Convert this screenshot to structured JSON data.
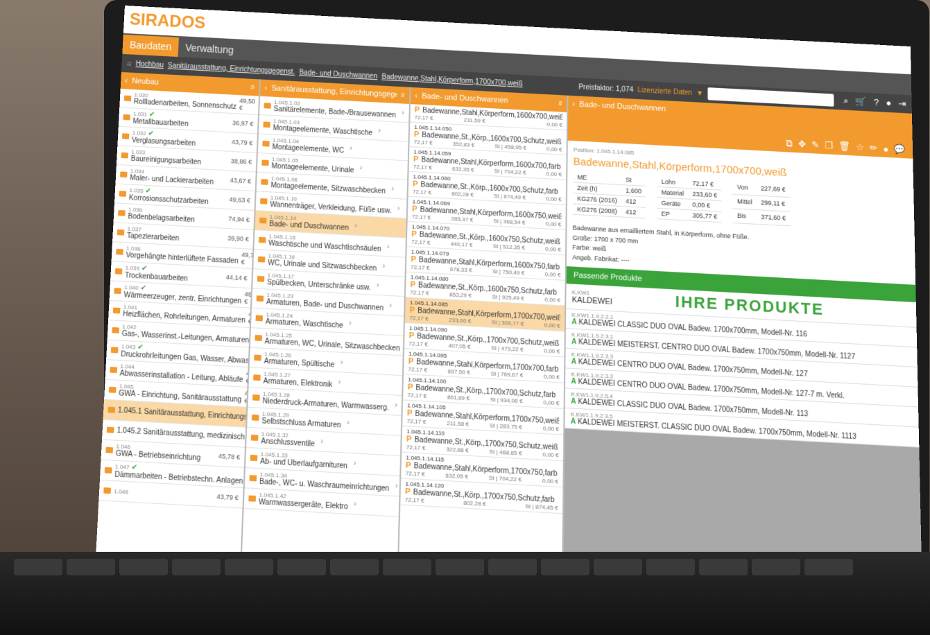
{
  "app": {
    "logo": "SIRADOS"
  },
  "nav": {
    "tabs": [
      "Baudaten",
      "Verwaltung"
    ]
  },
  "infobar": {
    "breadcrumbs": [
      "Hochbau",
      "Sanitärausstattung, Einrichtungsgegenst.",
      "Bade- und Duschwannen",
      "Badewanne,Stahl,Körperform,1700x700,weiß"
    ],
    "price_factor": "Preisfaktor: 1,074",
    "licensed": "Lizenzierte Daten"
  },
  "icons": [
    "home-icon",
    "search-icon",
    "cart-icon",
    "help-icon",
    "user-icon",
    "logout-icon",
    "filter-icon"
  ],
  "col1": {
    "title": "Neubau",
    "items": [
      {
        "code": "1.030",
        "label": "Rollladenarbeiten, Sonnenschutz",
        "price": "49,50 €"
      },
      {
        "code": "1.031",
        "label": "Metallbauarbeiten",
        "price": "36,97 €",
        "ok": true
      },
      {
        "code": "1.032",
        "label": "Verglasungsarbeiten",
        "price": "43,79 €",
        "ok": true
      },
      {
        "code": "1.033",
        "label": "Baureinigungsarbeiten",
        "price": "38,86 €"
      },
      {
        "code": "1.034",
        "label": "Maler- und Lackierarbeiten",
        "price": "43,67 €"
      },
      {
        "code": "1.035",
        "label": "Korrosionsschutzarbeiten",
        "price": "49,63 €",
        "ok": true
      },
      {
        "code": "1.036",
        "label": "Bodenbelagsarbeiten",
        "price": "74,94 €"
      },
      {
        "code": "1.037",
        "label": "Tapezierarbeiten",
        "price": "39,90 €"
      },
      {
        "code": "1.038",
        "label": "Vorgehängte hinterlüftete Fassaden",
        "price": "49,74 €"
      },
      {
        "code": "1.039",
        "label": "Trockenbauarbeiten",
        "price": "44,14 €",
        "ok": true
      },
      {
        "code": "1.040",
        "label": "Wärmeerzeuger, zentr. Einrichtungen",
        "price": "46,11 €",
        "ok": true
      },
      {
        "code": "1.041",
        "label": "Heizflächen, Rohrleitungen, Armaturen",
        "price": "49,11 €"
      },
      {
        "code": "1.042",
        "label": "Gas-, Wasserinst.-Leitungen, Armaturen",
        "price": "46,11 €"
      },
      {
        "code": "1.043",
        "label": "Druckrohrleitungen Gas, Wasser, Abwasser",
        "price": "48,11 €",
        "ok": true
      },
      {
        "code": "1.044",
        "label": "Abwasserinstallation - Leitung, Abläufe",
        "price": "42,44 €"
      },
      {
        "code": "1.045",
        "label": "GWA - Einrichtung, Sanitärausstattung",
        "price": "49,11 €"
      },
      {
        "code": "",
        "label": "1.045.1 Sanitärausstattung, Einrichtungsgegenst.",
        "price": "",
        "selected": true
      },
      {
        "code": "",
        "label": "1.045.2 Sanitärausstattung, medizinisch. Bereich",
        "price": ""
      },
      {
        "code": "1.046",
        "label": "GWA - Betriebseinrichtung",
        "price": "45,78 €"
      },
      {
        "code": "1.047",
        "label": "Dämmarbeiten - Betriebstechn. Anlagen",
        "price": "43,69 €",
        "ok": true
      },
      {
        "code": "1.048",
        "label": "",
        "price": "43,79 €"
      }
    ]
  },
  "col2": {
    "title": "Sanitärausstattung, Einrichtungsgegenst.",
    "items": [
      {
        "code": "1.045.1.02",
        "label": "Sanitärelemente, Bade-/Brausewannen"
      },
      {
        "code": "1.045.1.03",
        "label": "Montageelemente, Waschtische"
      },
      {
        "code": "1.045.1.04",
        "label": "Montageelemente, WC"
      },
      {
        "code": "1.045.1.05",
        "label": "Montageelemente, Urinale"
      },
      {
        "code": "1.045.1.06",
        "label": "Montageelemente, Sitzwaschbecken"
      },
      {
        "code": "1.045.1.10",
        "label": "Wannenträger, Verkleidung, Füße usw."
      },
      {
        "code": "1.045.1.14",
        "label": "Bade- und Duschwannen",
        "selected": true
      },
      {
        "code": "1.045.1.15",
        "label": "Waschtische und Waschtischsäulen"
      },
      {
        "code": "1.045.1.16",
        "label": "WC, Urinale und Sitzwaschbecken"
      },
      {
        "code": "1.045.1.17",
        "label": "Spülbecken, Unterschränke usw."
      },
      {
        "code": "1.045.1.23",
        "label": "Armaturen, Bade- und Duschwannen"
      },
      {
        "code": "1.045.1.24",
        "label": "Armaturen, Waschtische"
      },
      {
        "code": "1.045.1.25",
        "label": "Armaturen, WC, Urinale, Sitzwaschbecken"
      },
      {
        "code": "1.045.1.26",
        "label": "Armaturen, Spültische"
      },
      {
        "code": "1.045.1.27",
        "label": "Armaturen, Elektronik"
      },
      {
        "code": "1.045.1.28",
        "label": "Niederdruck-Armaturen, Warmwasserg."
      },
      {
        "code": "1.045.1.29",
        "label": "Selbstschluss Armaturen"
      },
      {
        "code": "1.045.1.32",
        "label": "Anschlussventile"
      },
      {
        "code": "1.045.1.33",
        "label": "Ab- und Überlaufgarnituren"
      },
      {
        "code": "1.045.1.34",
        "label": "Bade-, WC- u. Waschraumeinrichtungen"
      },
      {
        "code": "1.045.1.42",
        "label": "Warmwassergeräte, Elektro"
      }
    ]
  },
  "col3": {
    "title": "Bade- und Duschwannen",
    "items": [
      {
        "name": "Badewanne,Stahl,Körperform,1600x700,weiß",
        "code": "",
        "st": "",
        "ep": "72,17 €",
        "mat": "211,59 €",
        "extra": "0,00 €"
      },
      {
        "name": "Badewanne,St.,Körp.,1600x700,Schutz,weiß",
        "code": "1.045.1.14.050",
        "st": "St | 458,95 €",
        "ep": "72,17 €",
        "mat": "352,83 €",
        "extra": "0,00 €"
      },
      {
        "name": "Badewanne,Stahl,Körperform,1600x700,farb",
        "code": "1.045.1.14.059",
        "st": "St | 704,22 €",
        "ep": "72,17 €",
        "mat": "632,35 €",
        "extra": "0,00 €"
      },
      {
        "name": "Badewanne,St.,Körp.,1600x700,Schutz,farb",
        "code": "1.045.1.14.060",
        "st": "St | 874,49 €",
        "ep": "72,17 €",
        "mat": "802,28 €",
        "extra": "0,00 €"
      },
      {
        "name": "Badewanne,Stahl,Körperform,1600x750,weiß",
        "code": "1.045.1.14.069",
        "st": "St | 368,54 €",
        "ep": "72,17 €",
        "mat": "285,37 €",
        "extra": "0,00 €"
      },
      {
        "name": "Badewanne,St.,Körp.,1600x750,Schutz,weiß",
        "code": "1.045.1.14.070",
        "st": "St | 512,35 €",
        "ep": "72,17 €",
        "mat": "440,17 €",
        "extra": "0,00 €"
      },
      {
        "name": "Badewanne,Stahl,Körperform,1600x750,farb",
        "code": "1.045.1.14.079",
        "st": "St | 750,49 €",
        "ep": "72,17 €",
        "mat": "678,33 €",
        "extra": "0,00 €"
      },
      {
        "name": "Badewanne,St.,Körp.,1600x750,Schutz,farb",
        "code": "1.045.1.14.080",
        "st": "St | 925,49 €",
        "ep": "72,17 €",
        "mat": "853,29 €",
        "extra": "0,00 €"
      },
      {
        "name": "Badewanne,Stahl,Körperform,1700x700,weiß",
        "code": "1.045.1.14.085",
        "st": "St | 305,77 €",
        "ep": "72,17 €",
        "mat": "233,60 €",
        "extra": "0,00 €",
        "selected": true
      },
      {
        "name": "Badewanne,St.,Körp.,1700x700,Schutz,weiß",
        "code": "1.045.1.14.090",
        "st": "St | 479,22 €",
        "ep": "72,17 €",
        "mat": "407,05 €",
        "extra": "0,00 €"
      },
      {
        "name": "Badewanne,Stahl,Körperform,1700x700,farb",
        "code": "1.045.1.14.095",
        "st": "St | 769,67 €",
        "ep": "72,17 €",
        "mat": "697,50 €",
        "extra": "0,00 €"
      },
      {
        "name": "Badewanne,St.,Körp.,1700x700,Schutz,farb",
        "code": "1.045.1.14.100",
        "st": "St | 934,06 €",
        "ep": "72,17 €",
        "mat": "861,89 €",
        "extra": "0,00 €"
      },
      {
        "name": "Badewanne,Stahl,Körperform,1700x750,weiß",
        "code": "1.045.1.14.105",
        "st": "St | 283,75 €",
        "ep": "72,17 €",
        "mat": "211,58 €",
        "extra": "0,00 €"
      },
      {
        "name": "Badewanne,St.,Körp.,1700x750,Schutz,weiß",
        "code": "1.045.1.14.110",
        "st": "St | 468,85 €",
        "ep": "72,17 €",
        "mat": "322,88 €",
        "extra": "0,00 €"
      },
      {
        "name": "Badewanne,Stahl,Körperform,1700x750,farb",
        "code": "1.045.1.14.115",
        "st": "St | 704,22 €",
        "ep": "72,17 €",
        "mat": "632,05 €",
        "extra": "0,00 €"
      },
      {
        "name": "Badewanne,St.,Körp.,1700x750,Schutz,farb",
        "code": "1.045.1.14.120",
        "st": "St | 874,45 €",
        "ep": "72,17 €",
        "mat": "802,28 €",
        "extra": ""
      }
    ]
  },
  "detail": {
    "title": "Bade- und Duschwannen",
    "pos_code": "Position: 1.045.1.14.085",
    "name": "Badewanne,Stahl,Körperform,1700x700,weiß",
    "table1": [
      [
        "ME",
        "St"
      ],
      [
        "Zeit (h)",
        "1,600"
      ],
      [
        "KG276 (2016)",
        "412"
      ],
      [
        "KG276 (2008)",
        "412"
      ]
    ],
    "table2": [
      [
        "Lohn",
        "72,17 €"
      ],
      [
        "Material",
        "233,60 €"
      ],
      [
        "Geräte",
        "0,00 €"
      ],
      [
        "EP",
        "305,77 €"
      ]
    ],
    "table3": [
      [
        "Von",
        "227,69 €"
      ],
      [
        "Mittel",
        "299,11 €"
      ],
      [
        "Bis",
        "371,60 €"
      ]
    ],
    "desc": [
      "Badewanne aus emailliertem Stahl, in Körperform, ohne Füße.",
      "Größe: 1700 x 700 mm",
      "Farbe: weiß",
      "Angeb. Fabrikat: ----"
    ],
    "passende_head": "Passende Produkte",
    "brand": "KALDEWEI",
    "brand_code": "K.KW1",
    "banner": "IHRE PRODUKTE",
    "products": [
      {
        "code": "K.KW1.1.9.2.2.1",
        "name": "KALDEWEI CLASSIC DUO OVAL Badew. 1700x700mm, Modell-Nr. 116"
      },
      {
        "code": "K.KW1.1.9.2.3.1",
        "name": "KALDEWEI MEISTERST. CENTRO DUO OVAL Badew. 1700x750mm, Modell-Nr. 1127"
      },
      {
        "code": "K.KW1.1.9.2.3.3",
        "name": "KALDEWEI CENTRO DUO OVAL Badew. 1700x750mm, Modell-Nr. 127"
      },
      {
        "code": "K.KW1.1.9.2.3.3",
        "name": "KALDEWEI CENTRO DUO OVAL Badew. 1700x750mm, Modell-Nr. 127-7 m. Verkl."
      },
      {
        "code": "K.KW1.1.9.2.5.4",
        "name": "KALDEWEI CLASSIC DUO OVAL Badew. 1700x750mm, Modell-Nr. 113"
      },
      {
        "code": "K.KW1.1.9.2.3.5",
        "name": "KALDEWEI MEISTERST. CLASSIC DUO OVAL Badew. 1700x750mm, Modell-Nr. 1113"
      }
    ]
  }
}
